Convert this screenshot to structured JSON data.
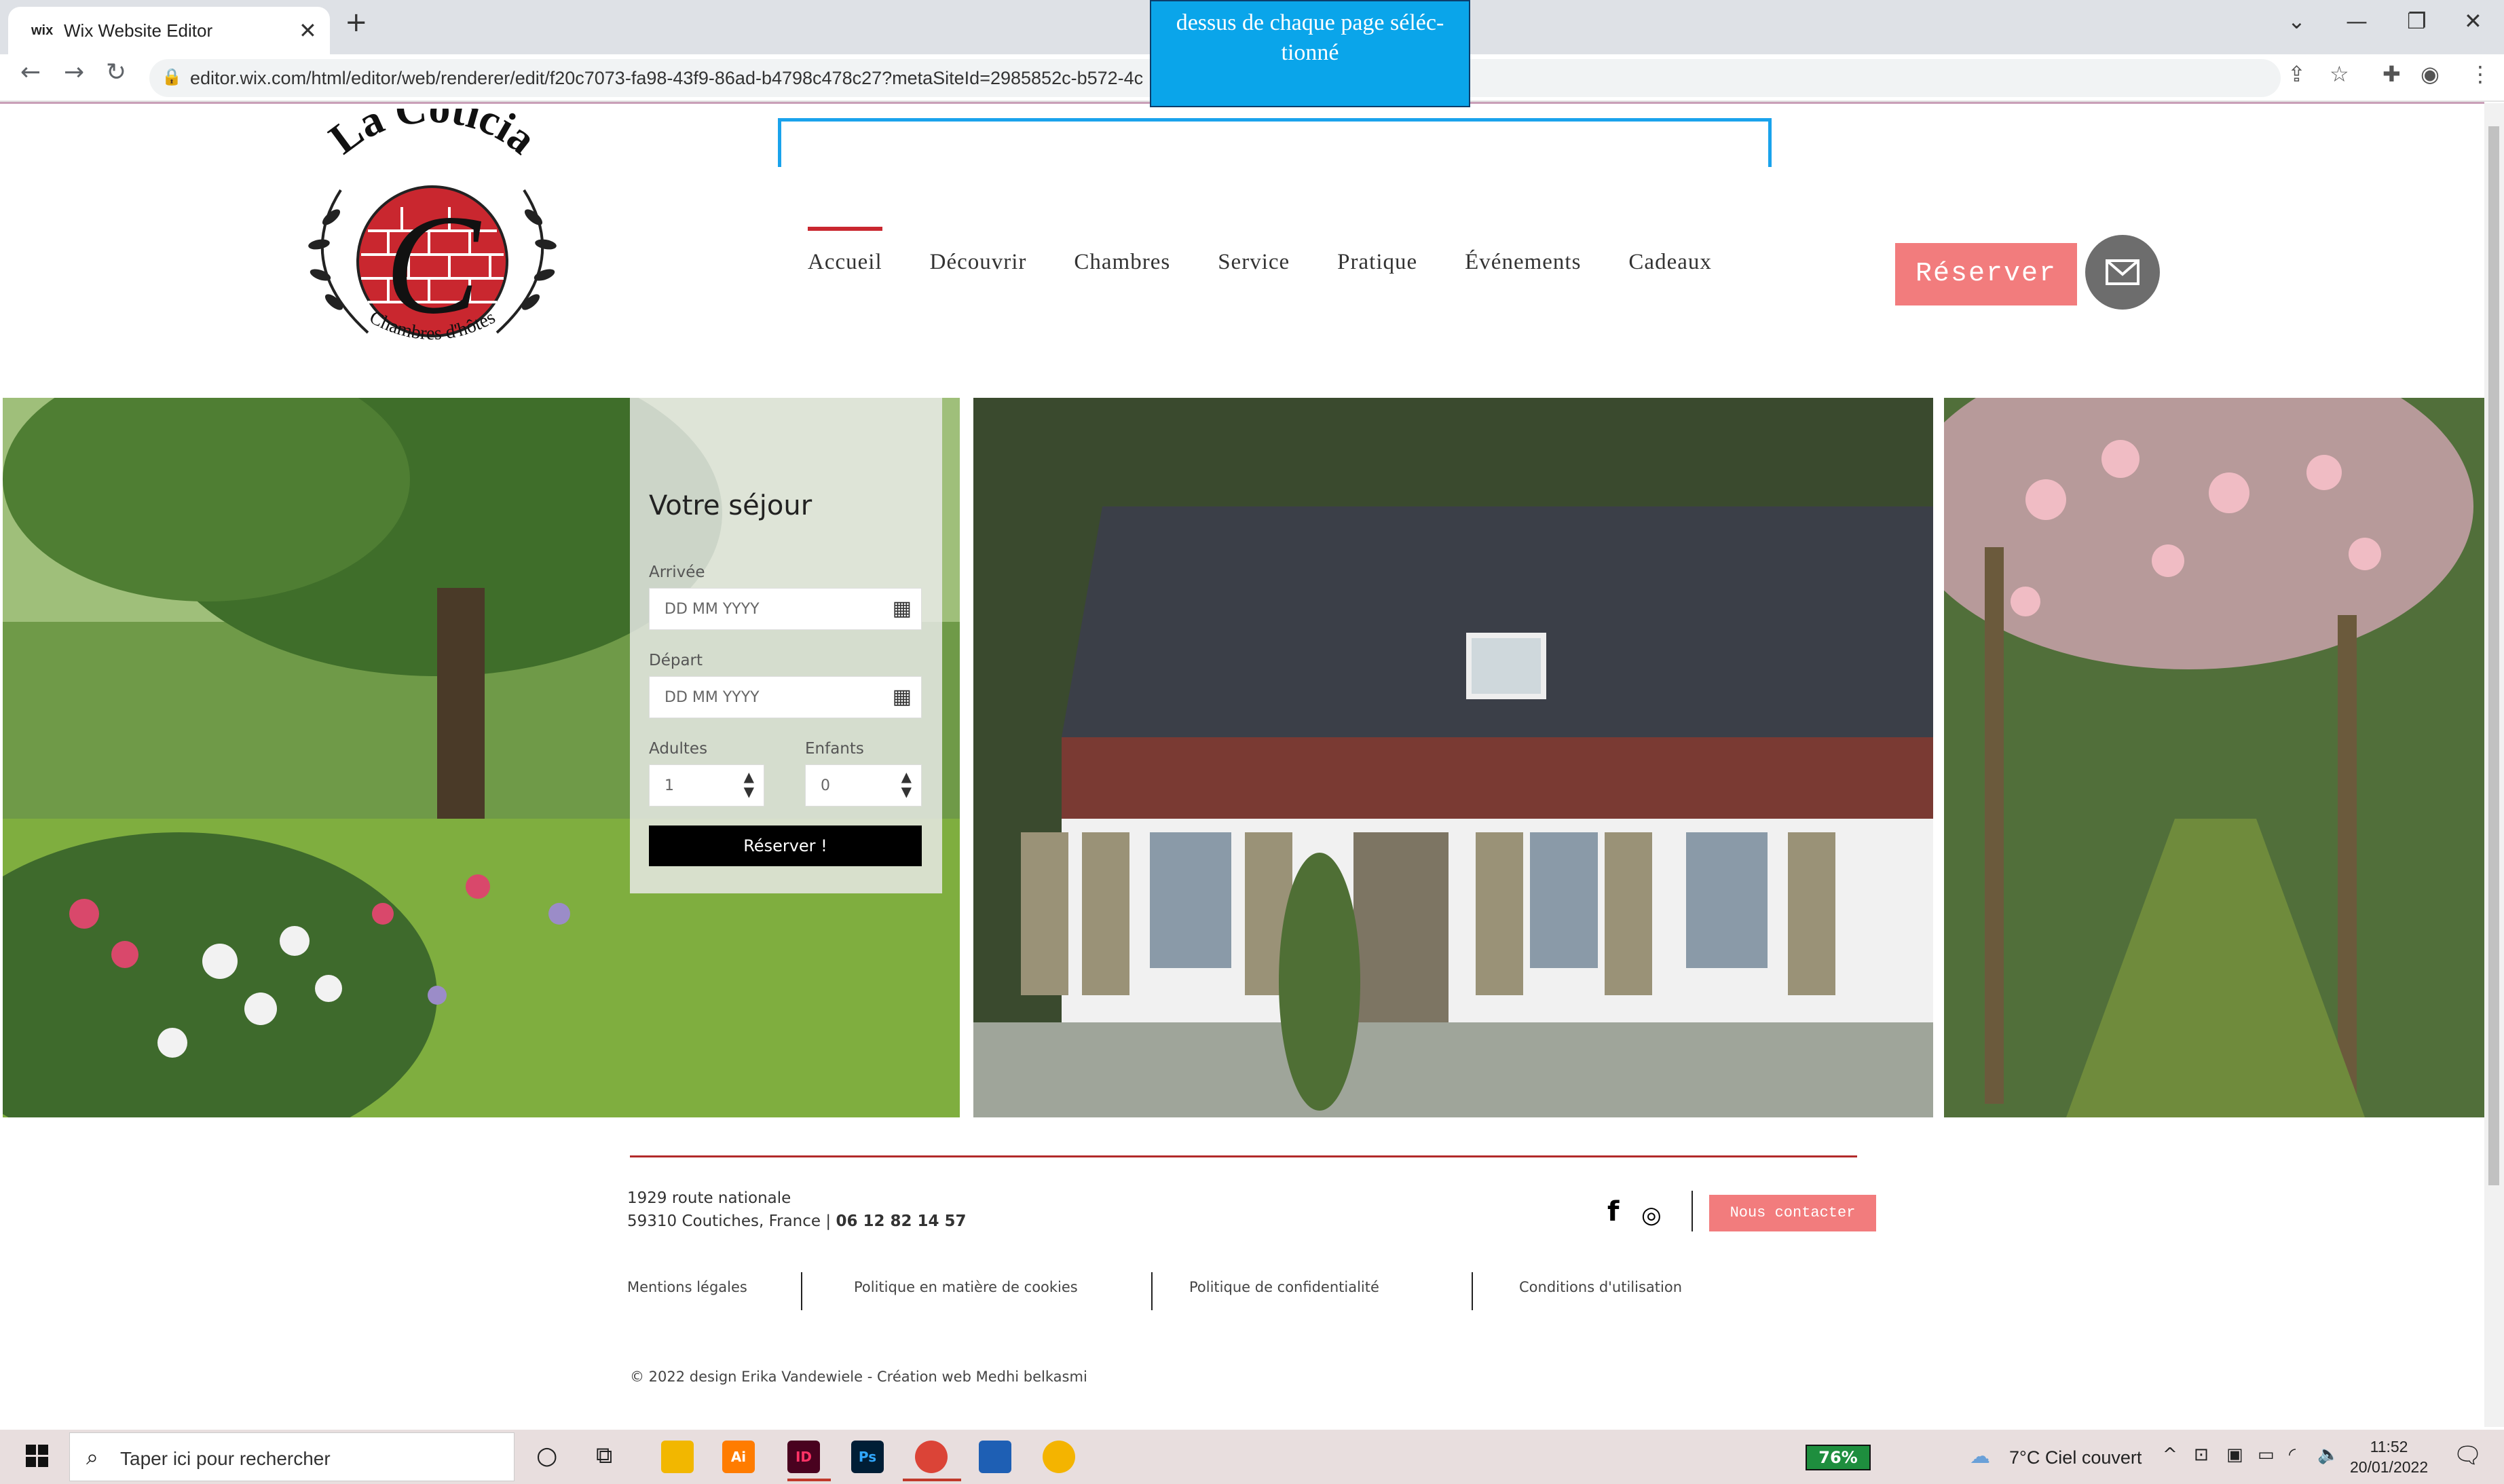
{
  "browser": {
    "tab_title": "Wix Website Editor",
    "tab_favicon": "wix",
    "url": "editor.wix.com/html/editor/web/renderer/edit/f20c7073-fa98-43f9-86ad-b4798c478c27?metaSiteId=2985852c-b572-4c"
  },
  "editor": {
    "tooltip_lines": [
      "dessus de chaque page séléc-",
      "tionné"
    ]
  },
  "site": {
    "logo": {
      "name": "La Coticia",
      "subtitle": "Chambres d'hôtes",
      "monogram": "C",
      "accent": "#c9272f"
    },
    "nav": [
      "Accueil",
      "Découvrir",
      "Chambres",
      "Service",
      "Pratique",
      "Événements",
      "Cadeaux"
    ],
    "reserve_label": "Réserver",
    "accent_color": "#f27c7d",
    "booking": {
      "title": "Votre séjour",
      "arrival_label": "Arrivée",
      "arrival_placeholder": "DD MM YYYY",
      "departure_label": "Départ",
      "departure_placeholder": "DD MM YYYY",
      "adults_label": "Adultes",
      "adults_value": "1",
      "children_label": "Enfants",
      "children_value": "0",
      "submit_label": "Réserver !"
    },
    "footer": {
      "address_line1": "1929 route nationale",
      "address_line2": "59310 Coutiches, France |",
      "phone": "06 12 82 14 57",
      "contact_label": "Nous contacter",
      "links": [
        "Mentions légales",
        "Politique en matière de cookies",
        "Politique de confidentialité",
        "Conditions d'utilisation"
      ],
      "copyright": "© 2022 design Erika Vandewiele - Création web  Medhi belkasmi"
    }
  },
  "taskbar": {
    "search_placeholder": "Taper ici pour rechercher",
    "battery": "76%",
    "weather": "7°C  Ciel couvert",
    "time": "11:52",
    "date": "20/01/2022",
    "apps": [
      "Ai",
      "ID",
      "Ps"
    ]
  }
}
